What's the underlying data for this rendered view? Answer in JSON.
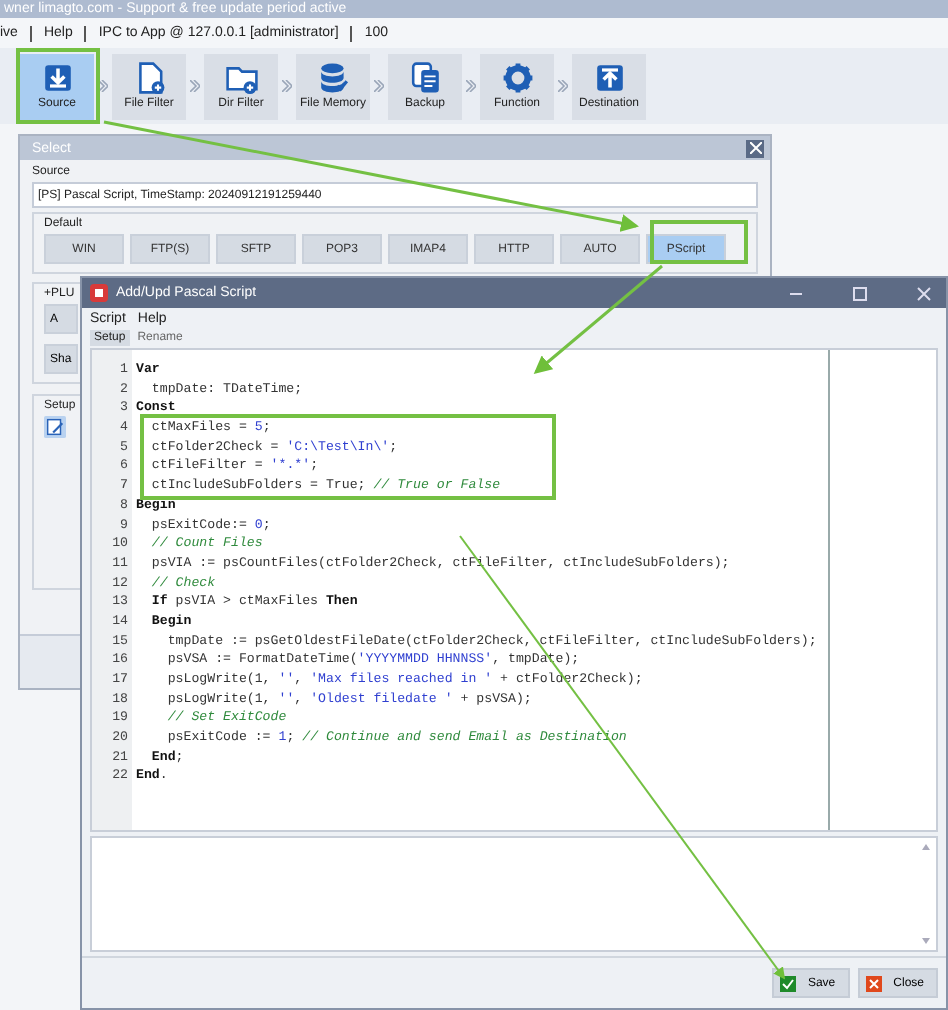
{
  "app_title": "wner limagto.com - Support & free update period active",
  "menu": [
    "ive",
    "Help"
  ],
  "ipc_status": "IPC to App @ 127.0.0.1 [administrator]",
  "count": "100",
  "toolbar": [
    {
      "label": "Source",
      "selected": true
    },
    {
      "label": "File Filter",
      "selected": false
    },
    {
      "label": "Dir Filter",
      "selected": false
    },
    {
      "label": "File Memory",
      "selected": false
    },
    {
      "label": "Backup",
      "selected": false
    },
    {
      "label": "Function",
      "selected": false
    },
    {
      "label": "Destination",
      "selected": false
    }
  ],
  "select_window": {
    "title": "Select",
    "source_label": "Source",
    "source_value": "[PS] Pascal Script, TimeStamp: 20240912191259440",
    "default_label": "Default",
    "protocols": [
      {
        "label": "WIN",
        "selected": false
      },
      {
        "label": "FTP(S)",
        "selected": false
      },
      {
        "label": "SFTP",
        "selected": false
      },
      {
        "label": "POP3",
        "selected": false
      },
      {
        "label": "IMAP4",
        "selected": false
      },
      {
        "label": "HTTP",
        "selected": false
      },
      {
        "label": "AUTO",
        "selected": false
      },
      {
        "label": "PScript",
        "selected": true
      }
    ],
    "plugin_label": "+PLU",
    "plugin_buttons": [
      "A",
      "Sha"
    ],
    "setup_label": "Setup"
  },
  "script_window": {
    "title": "Add/Upd Pascal Script",
    "menu": [
      "Script",
      "Help"
    ],
    "tabs": [
      {
        "label": "Setup",
        "selected": true
      },
      {
        "label": "Rename",
        "selected": false
      }
    ],
    "code": [
      {
        "number": "1",
        "tokens": [
          {
            "kind": "keyword",
            "text": "Var"
          }
        ]
      },
      {
        "number": "2",
        "tokens": [
          {
            "kind": "plain",
            "text": "  tmpDate: TDateTime;"
          }
        ]
      },
      {
        "number": "3",
        "tokens": [
          {
            "kind": "keyword",
            "text": "Const"
          }
        ]
      },
      {
        "number": "4",
        "tokens": [
          {
            "kind": "plain",
            "text": "  ctMaxFiles = "
          },
          {
            "kind": "literal",
            "text": "5"
          },
          {
            "kind": "plain",
            "text": ";"
          }
        ]
      },
      {
        "number": "5",
        "tokens": [
          {
            "kind": "plain",
            "text": "  ctFolder2Check = "
          },
          {
            "kind": "literal",
            "text": "'C:\\Test\\In\\'"
          },
          {
            "kind": "plain",
            "text": ";"
          }
        ]
      },
      {
        "number": "6",
        "tokens": [
          {
            "kind": "plain",
            "text": "  ctFileFilter = "
          },
          {
            "kind": "literal",
            "text": "'*.*'"
          },
          {
            "kind": "plain",
            "text": ";"
          }
        ]
      },
      {
        "number": "7",
        "tokens": [
          {
            "kind": "plain",
            "text": "  ctIncludeSubFolders = True; "
          },
          {
            "kind": "comment",
            "text": "// True or False"
          }
        ]
      },
      {
        "number": "8",
        "tokens": [
          {
            "kind": "keyword",
            "text": "Begin"
          }
        ]
      },
      {
        "number": "9",
        "tokens": [
          {
            "kind": "plain",
            "text": "  psExitCode:= "
          },
          {
            "kind": "literal",
            "text": "0"
          },
          {
            "kind": "plain",
            "text": ";"
          }
        ]
      },
      {
        "number": "10",
        "tokens": [
          {
            "kind": "comment",
            "text": "  // Count Files"
          }
        ]
      },
      {
        "number": "11",
        "tokens": [
          {
            "kind": "plain",
            "text": "  psVIA := psCountFiles(ctFolder2Check, ctFileFilter, ctIncludeSubFolders);"
          }
        ]
      },
      {
        "number": "12",
        "tokens": [
          {
            "kind": "comment",
            "text": "  // Check"
          }
        ]
      },
      {
        "number": "13",
        "tokens": [
          {
            "kind": "keyword",
            "text": "  If"
          },
          {
            "kind": "plain",
            "text": " psVIA > ctMaxFiles "
          },
          {
            "kind": "keyword",
            "text": "Then"
          }
        ]
      },
      {
        "number": "14",
        "tokens": [
          {
            "kind": "keyword",
            "text": "  Begin"
          }
        ]
      },
      {
        "number": "15",
        "tokens": [
          {
            "kind": "plain",
            "text": "    tmpDate := psGetOldestFileDate(ctFolder2Check, ctFileFilter, ctIncludeSubFolders);"
          }
        ]
      },
      {
        "number": "16",
        "tokens": [
          {
            "kind": "plain",
            "text": "    psVSA := FormatDateTime("
          },
          {
            "kind": "literal",
            "text": "'YYYYMMDD HHNNSS'"
          },
          {
            "kind": "plain",
            "text": ", tmpDate);"
          }
        ]
      },
      {
        "number": "17",
        "tokens": [
          {
            "kind": "plain",
            "text": "    psLogWrite(1, "
          },
          {
            "kind": "literal",
            "text": "''"
          },
          {
            "kind": "plain",
            "text": ", "
          },
          {
            "kind": "literal",
            "text": "'Max files reached in '"
          },
          {
            "kind": "plain",
            "text": " + ctFolder2Check);"
          }
        ]
      },
      {
        "number": "18",
        "tokens": [
          {
            "kind": "plain",
            "text": "    psLogWrite(1, "
          },
          {
            "kind": "literal",
            "text": "''"
          },
          {
            "kind": "plain",
            "text": ", "
          },
          {
            "kind": "literal",
            "text": "'Oldest filedate '"
          },
          {
            "kind": "plain",
            "text": " + psVSA);"
          }
        ]
      },
      {
        "number": "19",
        "tokens": [
          {
            "kind": "comment",
            "text": "    // Set ExitCode"
          }
        ]
      },
      {
        "number": "20",
        "tokens": [
          {
            "kind": "plain",
            "text": "    psExitCode := "
          },
          {
            "kind": "literal",
            "text": "1"
          },
          {
            "kind": "plain",
            "text": "; "
          },
          {
            "kind": "comment",
            "text": "// Continue and send Email as Destination"
          }
        ]
      },
      {
        "number": "21",
        "tokens": [
          {
            "kind": "keyword",
            "text": "  End"
          },
          {
            "kind": "plain",
            "text": ";"
          }
        ]
      },
      {
        "number": "22",
        "tokens": [
          {
            "kind": "keyword",
            "text": "End"
          },
          {
            "kind": "plain",
            "text": "."
          }
        ]
      }
    ],
    "buttons": [
      {
        "label": "Save",
        "kind": "save"
      },
      {
        "label": "Close",
        "kind": "close"
      }
    ]
  }
}
